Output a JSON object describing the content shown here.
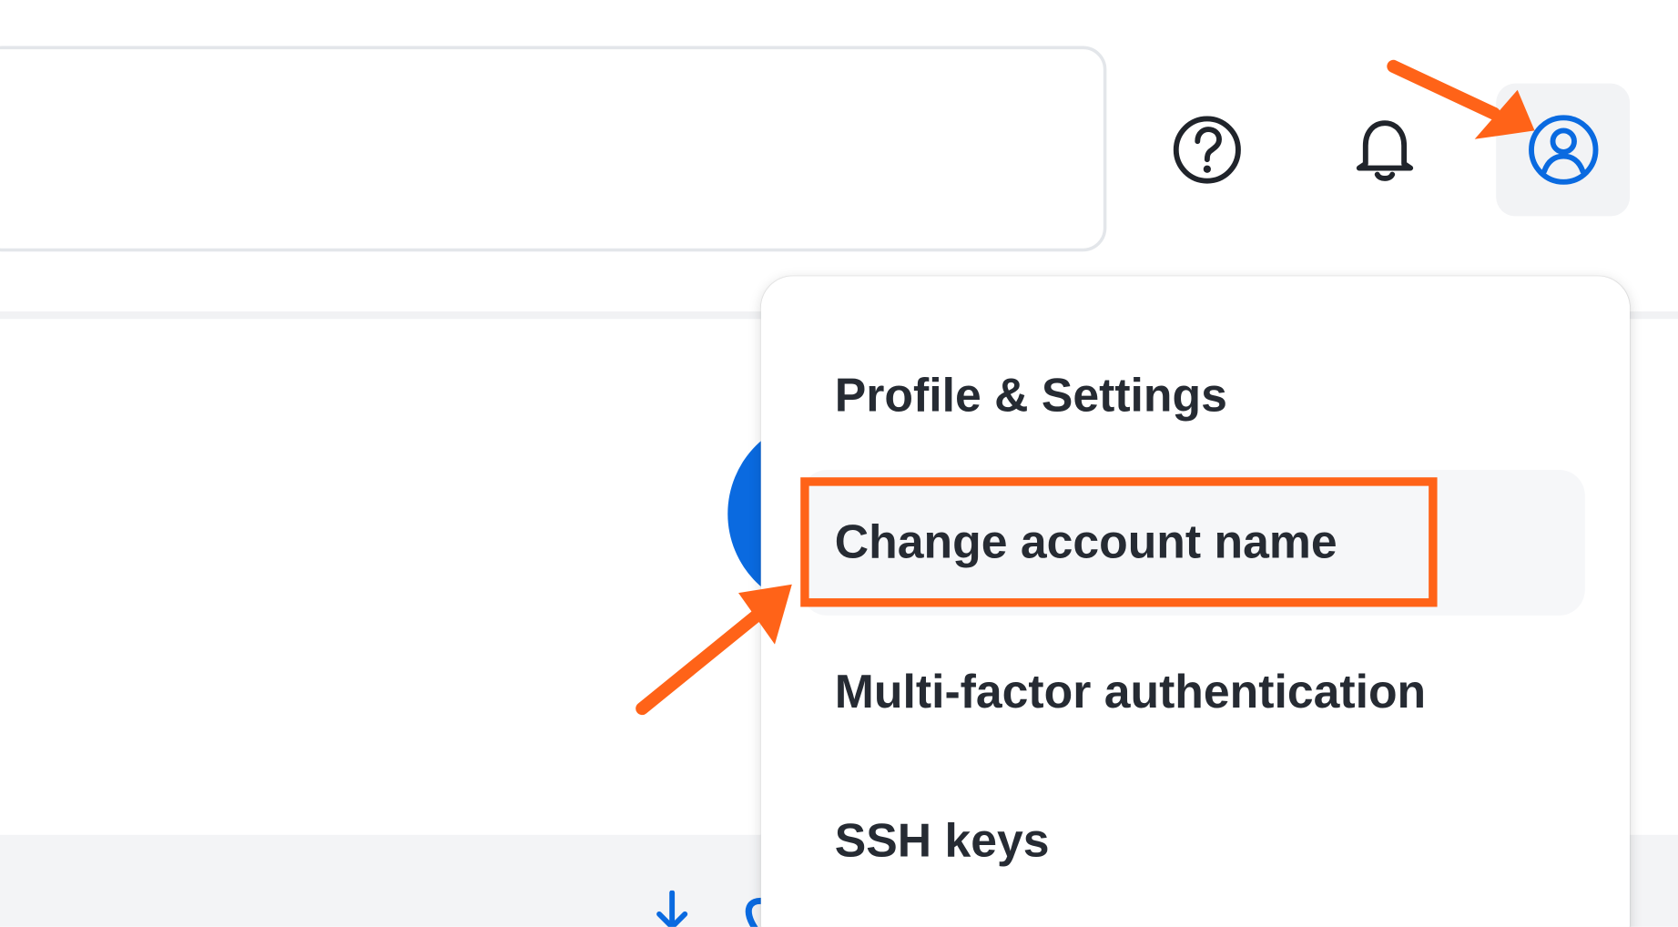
{
  "header": {
    "search_input": {
      "value": "",
      "placeholder": ""
    },
    "icons": {
      "help": "question-circle-icon",
      "notifications": "bell-icon",
      "account": "user-circle-icon"
    }
  },
  "account_menu": {
    "items": [
      {
        "label": "Profile & Settings"
      },
      {
        "label": "Change account name"
      },
      {
        "label": "Multi-factor authentication"
      },
      {
        "label": "SSH keys"
      }
    ]
  },
  "annotations": {
    "highlighted_item": "Change account name",
    "accent_color": "#ff6318"
  },
  "colors": {
    "text": "#262b33",
    "account_icon": "#0a6ae0",
    "highlight_background": "#f6f7f9"
  }
}
